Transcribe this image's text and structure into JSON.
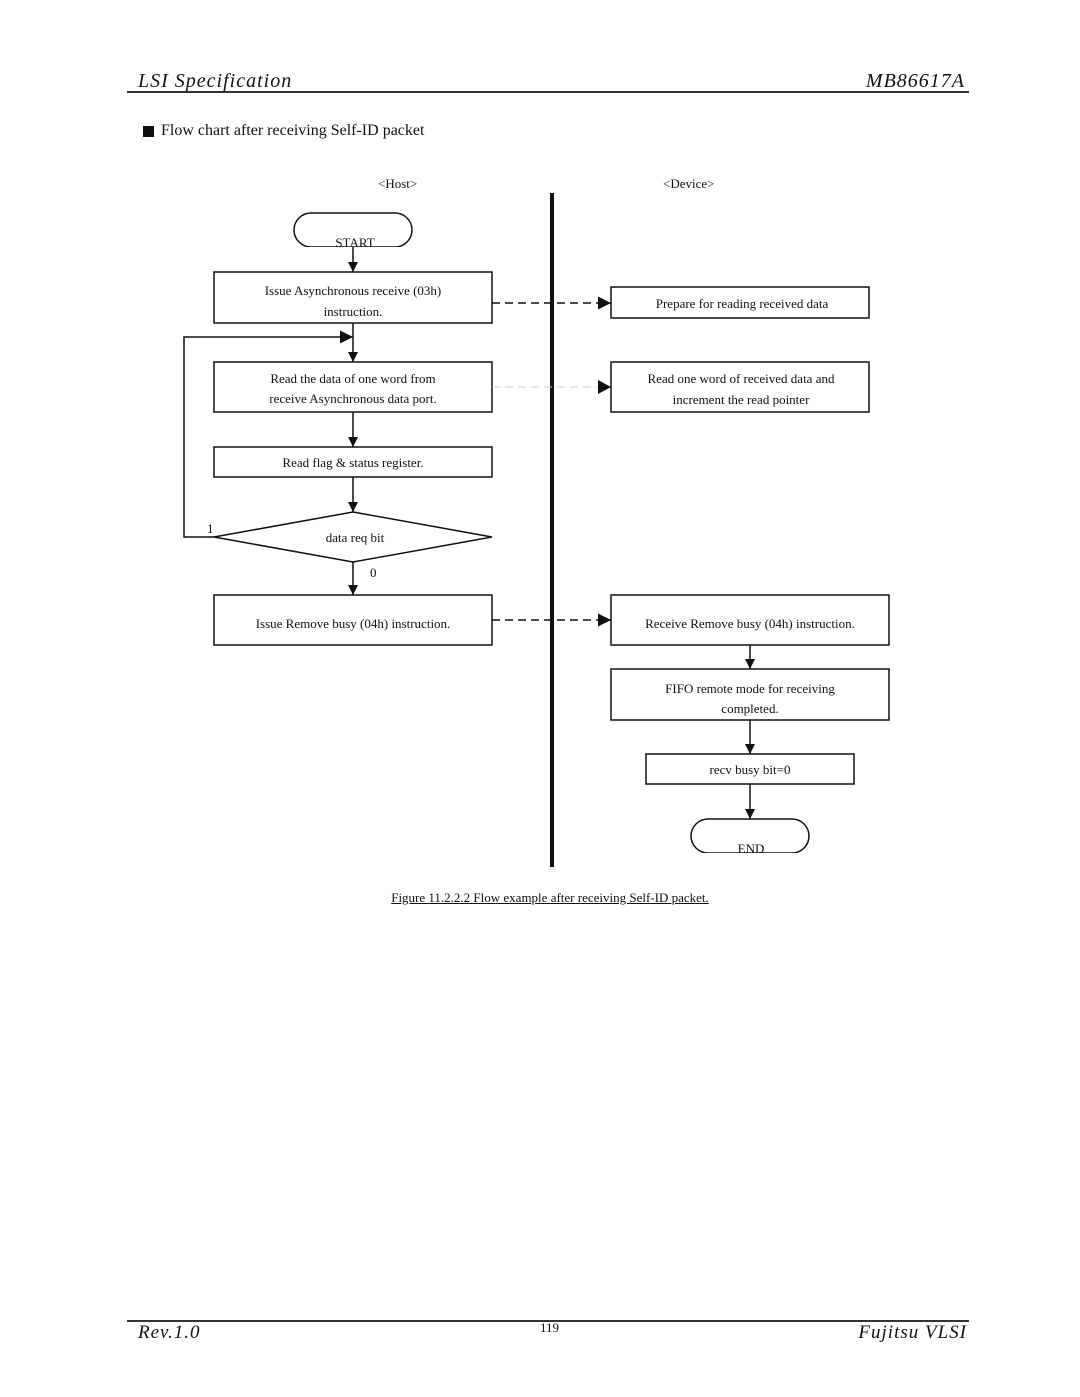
{
  "header": {
    "left": "LSI Specification",
    "right": "MB86617A"
  },
  "section_title": "Flow chart after receiving Self-ID packet",
  "lanes": {
    "host": "<Host>",
    "device": "<Device>"
  },
  "host_flow": {
    "start": "START",
    "step1": [
      "Issue Asynchronous receive (03h)",
      "instruction."
    ],
    "step2": [
      "Read the data of one word from",
      "receive Asynchronous data port."
    ],
    "step3": "Read flag & status register.",
    "decision": "data req bit",
    "decision_yes": "1",
    "decision_no": "0",
    "step4": "Issue Remove busy (04h) instruction."
  },
  "device_flow": {
    "step1": "Prepare for reading received data",
    "step2": [
      "Read one word of received data and",
      "increment the read pointer"
    ],
    "step3": "Receive Remove busy (04h) instruction.",
    "step4": [
      "FIFO remote mode for receiving",
      "completed."
    ],
    "step5": "recv busy bit=0",
    "end": "END"
  },
  "caption": "Figure 11.2.2.2  Flow example after receiving Self-ID packet.",
  "footer": {
    "left": "Rev.1.0",
    "page": "119",
    "right": "Fujitsu VLSI"
  }
}
